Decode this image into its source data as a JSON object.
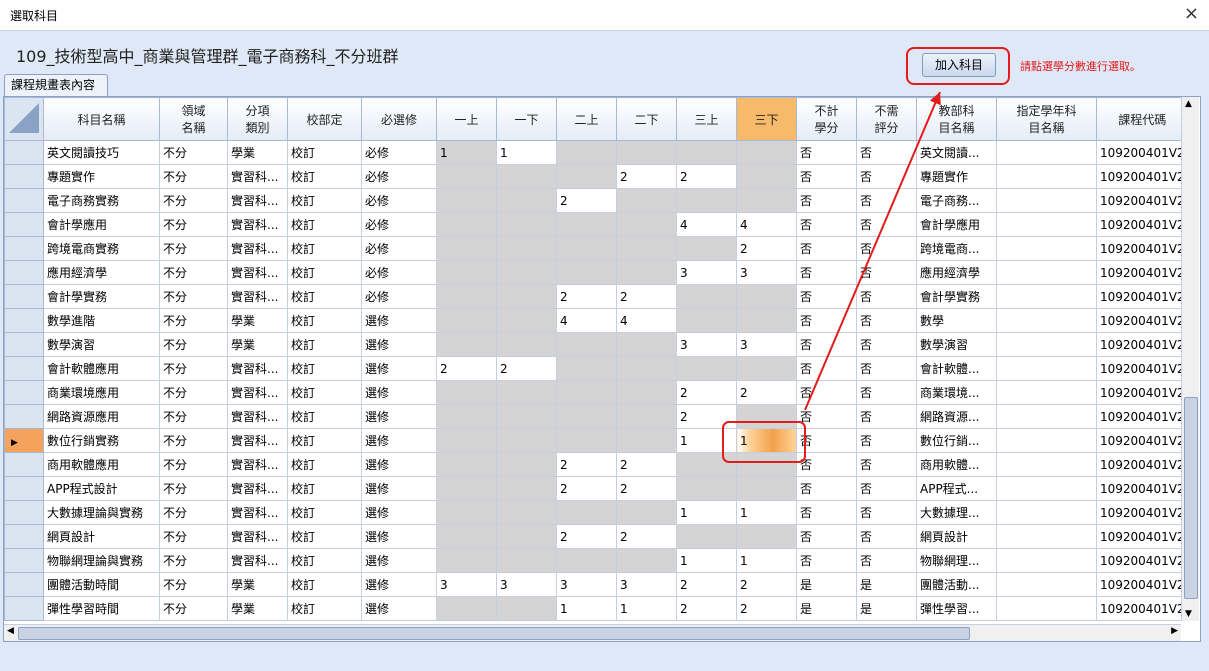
{
  "window": {
    "title": "選取科目",
    "close": "×"
  },
  "header": {
    "heading": "109_技術型高中_商業與管理群_電子商務科_不分班群",
    "add_button": "加入科目",
    "hint": "請點選學分數進行選取。"
  },
  "tab": {
    "label": "課程規畫表內容"
  },
  "grid": {
    "columns": [
      "科目名稱",
      "領域\n名稱",
      "分項\n類別",
      "校部定",
      "必選修",
      "一上",
      "一下",
      "二上",
      "二下",
      "三上",
      "三下",
      "不計\n學分",
      "不需\n評分",
      "教部科\n目名稱",
      "指定學年科\n目名稱",
      "課程代碼"
    ],
    "selected_column": "三下",
    "rows": [
      [
        "英文閱讀技巧",
        "不分",
        "學業",
        "校訂",
        "必修",
        "1",
        "1",
        "",
        "",
        "",
        "",
        "否",
        "否",
        "英文閱讀...",
        "",
        "109200401V2"
      ],
      [
        "專題實作",
        "不分",
        "實習科...",
        "校訂",
        "必修",
        "",
        "",
        "",
        "2",
        "2",
        "",
        "否",
        "否",
        "專題實作",
        "",
        "109200401V2"
      ],
      [
        "電子商務實務",
        "不分",
        "實習科...",
        "校訂",
        "必修",
        "",
        "",
        "2",
        "",
        "",
        "",
        "否",
        "否",
        "電子商務...",
        "",
        "109200401V2"
      ],
      [
        "會計學應用",
        "不分",
        "實習科...",
        "校訂",
        "必修",
        "",
        "",
        "",
        "",
        "4",
        "4",
        "否",
        "否",
        "會計學應用",
        "",
        "109200401V2"
      ],
      [
        "跨境電商實務",
        "不分",
        "實習科...",
        "校訂",
        "必修",
        "",
        "",
        "",
        "",
        "",
        "2",
        "否",
        "否",
        "跨境電商...",
        "",
        "109200401V2"
      ],
      [
        "應用經濟學",
        "不分",
        "實習科...",
        "校訂",
        "必修",
        "",
        "",
        "",
        "",
        "3",
        "3",
        "否",
        "否",
        "應用經濟學",
        "",
        "109200401V2"
      ],
      [
        "會計學實務",
        "不分",
        "實習科...",
        "校訂",
        "必修",
        "",
        "",
        "2",
        "2",
        "",
        "",
        "否",
        "否",
        "會計學實務",
        "",
        "109200401V2"
      ],
      [
        "數學進階",
        "不分",
        "學業",
        "校訂",
        "選修",
        "",
        "",
        "4",
        "4",
        "",
        "",
        "否",
        "否",
        "數學",
        "",
        "109200401V2"
      ],
      [
        "數學演習",
        "不分",
        "學業",
        "校訂",
        "選修",
        "",
        "",
        "",
        "",
        "3",
        "3",
        "否",
        "否",
        "數學演習",
        "",
        "109200401V2"
      ],
      [
        "會計軟體應用",
        "不分",
        "實習科...",
        "校訂",
        "選修",
        "2",
        "2",
        "",
        "",
        "",
        "",
        "否",
        "否",
        "會計軟體...",
        "",
        "109200401V2"
      ],
      [
        "商業環境應用",
        "不分",
        "實習科...",
        "校訂",
        "選修",
        "",
        "",
        "",
        "",
        "2",
        "2",
        "否",
        "否",
        "商業環境...",
        "",
        "109200401V2"
      ],
      [
        "網路資源應用",
        "不分",
        "實習科...",
        "校訂",
        "選修",
        "",
        "",
        "",
        "",
        "2",
        "",
        "否",
        "否",
        "網路資源...",
        "",
        "109200401V2"
      ],
      [
        "數位行銷實務",
        "不分",
        "實習科...",
        "校訂",
        "選修",
        "",
        "",
        "",
        "",
        "1",
        "1",
        "否",
        "否",
        "數位行銷...",
        "",
        "109200401V2"
      ],
      [
        "商用軟體應用",
        "不分",
        "實習科...",
        "校訂",
        "選修",
        "",
        "",
        "2",
        "2",
        "",
        "",
        "否",
        "否",
        "商用軟體...",
        "",
        "109200401V2"
      ],
      [
        "APP程式設計",
        "不分",
        "實習科...",
        "校訂",
        "選修",
        "",
        "",
        "2",
        "2",
        "",
        "",
        "否",
        "否",
        "APP程式...",
        "",
        "109200401V2"
      ],
      [
        "大數據理論與實務",
        "不分",
        "實習科...",
        "校訂",
        "選修",
        "",
        "",
        "",
        "",
        "1",
        "1",
        "否",
        "否",
        "大數據理...",
        "",
        "109200401V2"
      ],
      [
        "網頁設計",
        "不分",
        "實習科...",
        "校訂",
        "選修",
        "",
        "",
        "2",
        "2",
        "",
        "",
        "否",
        "否",
        "網頁設計",
        "",
        "109200401V2"
      ],
      [
        "物聯網理論與實務",
        "不分",
        "實習科...",
        "校訂",
        "選修",
        "",
        "",
        "",
        "",
        "1",
        "1",
        "否",
        "否",
        "物聯網理...",
        "",
        "109200401V2"
      ],
      [
        "團體活動時間",
        "不分",
        "學業",
        "校訂",
        "選修",
        "3",
        "3",
        "3",
        "3",
        "2",
        "2",
        "是",
        "是",
        "團體活動...",
        "",
        "109200401V2"
      ],
      [
        "彈性學習時間",
        "不分",
        "學業",
        "校訂",
        "選修",
        "",
        "",
        "1",
        "1",
        "2",
        "2",
        "是",
        "是",
        "彈性學習...",
        "",
        "109200401V2"
      ]
    ],
    "gray_cells": [
      [
        0,
        2,
        3,
        4,
        5
      ],
      [
        0,
        1,
        2,
        5
      ],
      [
        0,
        1,
        3,
        4,
        5
      ],
      [
        0,
        1,
        2,
        3
      ],
      [
        0,
        1,
        2,
        3,
        4
      ],
      [
        0,
        1,
        2,
        3
      ],
      [
        0,
        1,
        4,
        5
      ],
      [
        0,
        1,
        4,
        5
      ],
      [
        0,
        1,
        2,
        3
      ],
      [
        2,
        3,
        4,
        5
      ],
      [
        0,
        1,
        2,
        3
      ],
      [
        0,
        1,
        2,
        3,
        5
      ],
      [
        0,
        1,
        2,
        3
      ],
      [
        0,
        1,
        4,
        5
      ],
      [
        0,
        1,
        4,
        5
      ],
      [
        0,
        1,
        2,
        3
      ],
      [
        0,
        1,
        4,
        5
      ],
      [
        0,
        1,
        2,
        3
      ],
      [],
      [
        0,
        1
      ]
    ],
    "current_row": 12,
    "highlight_cell": {
      "row": 12,
      "semester": "三下"
    }
  },
  "colors": {
    "accent_red": "#e41b1b",
    "selected_header": "#f7b96a",
    "gray_cell": "#d4d4d4",
    "current_row_marker": "#f5a25d"
  }
}
